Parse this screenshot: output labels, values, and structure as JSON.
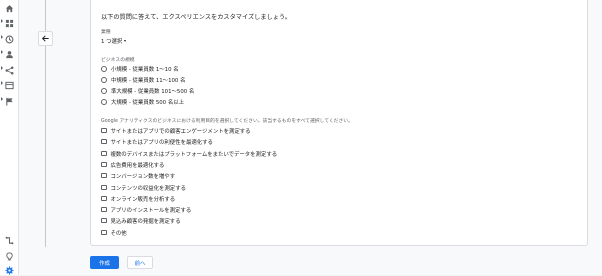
{
  "intro_text": "以下の質問に答えて、エクスペリエンスをカスタマイズしましょう。",
  "industry": {
    "label": "業種",
    "selected": "1 つ選択"
  },
  "business_size": {
    "label": "ビジネスの規模",
    "options": [
      "小規模 - 従業員数 1～10 名",
      "中規模 - 従業員数 11～100 名",
      "準大規模 - 従業員数 101～500 名",
      "大規模 - 従業員数 500 名以上"
    ]
  },
  "usage": {
    "label": "Google アナリティクスのビジネスにおける利用目的を選択してください。該当するものをすべて選択してください。",
    "options": [
      "サイトまたはアプリでの顧客エンゲージメントを測定する",
      "サイトまたはアプリの利便性を最適化する",
      "複数のデバイスまたはプラットフォームをまたいでデータを測定する",
      "広告費用を最適化する",
      "コンバージョン数を増やす",
      "コンテンツの収益化を測定する",
      "オンライン販売を分析する",
      "アプリのインストールを測定する",
      "見込み顧客の発掘を測定する",
      "その他"
    ]
  },
  "buttons": {
    "create": "作成",
    "back": "前へ"
  },
  "icons": {
    "rail": [
      "home-icon",
      "reports-icon",
      "explore-icon",
      "audience-icon",
      "path-icon",
      "table-icon",
      "flag-icon"
    ],
    "rail_bottom": [
      "connector-icon",
      "lightbulb-icon",
      "settings-icon"
    ],
    "back": "arrow-left-icon"
  },
  "colors": {
    "primary": "#1a73e8",
    "settings_active": "#1a73e8"
  }
}
